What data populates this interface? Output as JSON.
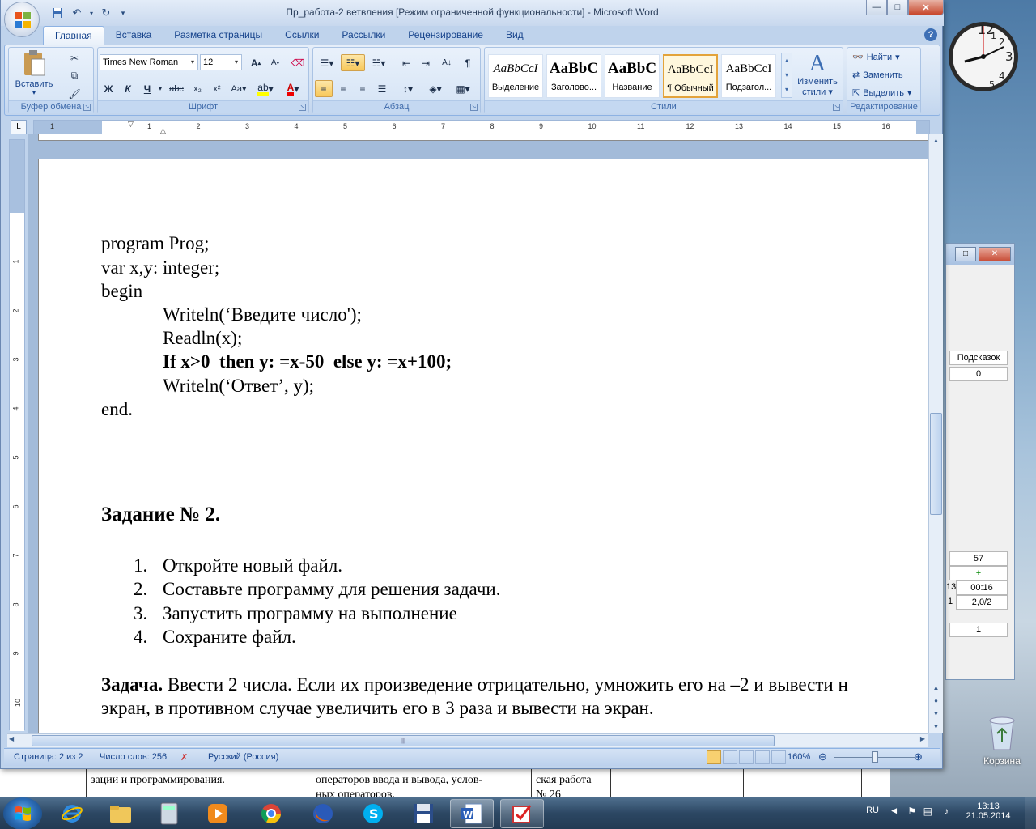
{
  "window": {
    "title": "Пр_работа-2 ветвления [Режим ограниченной функциональности] - Microsoft Word"
  },
  "tabs": [
    "Главная",
    "Вставка",
    "Разметка страницы",
    "Ссылки",
    "Рассылки",
    "Рецензирование",
    "Вид"
  ],
  "active_tab": "Главная",
  "ribbon": {
    "clipboard": {
      "label": "Буфер обмена",
      "paste": "Вставить"
    },
    "font": {
      "label": "Шрифт",
      "name": "Times New Roman",
      "size": "12"
    },
    "paragraph": {
      "label": "Абзац"
    },
    "styles": {
      "label": "Стили",
      "change": "Изменить",
      "change2": "стили",
      "items": [
        {
          "sample": "AaBbCcI",
          "name": "Выделение"
        },
        {
          "sample": "AaBbC",
          "name": "Заголово..."
        },
        {
          "sample": "AaBbC",
          "name": "Название"
        },
        {
          "sample": "AaBbCcI",
          "name": "¶ Обычный"
        },
        {
          "sample": "AaBbCcI",
          "name": "Подзагол..."
        }
      ]
    },
    "editing": {
      "label": "Редактирование",
      "find": "Найти",
      "replace": "Заменить",
      "select": "Выделить"
    }
  },
  "ruler": {
    "h": [
      "1",
      "1",
      "2",
      "3",
      "4",
      "5",
      "6",
      "7",
      "8",
      "9",
      "10",
      "11",
      "12",
      "13",
      "14",
      "15",
      "16"
    ],
    "v": [
      "1",
      "2",
      "3",
      "4",
      "5",
      "6",
      "7",
      "8",
      "9",
      "10"
    ]
  },
  "document": {
    "code": [
      "program Prog;",
      "var x,y: integer;",
      "begin",
      "Writeln(‘Введите число');",
      "Readln(x);",
      "If x>0  then y: =x-50  else y: =x+100;",
      "Writeln(‘Ответ’, y);",
      "end."
    ],
    "heading": "Задание № 2.",
    "steps": [
      {
        "n": "1.",
        "text": "Откройте новый файл."
      },
      {
        "n": "2.",
        "text": "Составьте программу для решения задачи."
      },
      {
        "n": "3.",
        "text": "Запустить программу на выполнение"
      },
      {
        "n": "4.",
        "text": "Сохраните файл."
      }
    ],
    "task_label": "Задача.",
    "task_line1": " Ввести 2 числа. Если их произведение отрицательно, умножить его на –2 и вывести н",
    "task_line2": "экран, в противном случае увеличить его в 3 раза и вывести на экран."
  },
  "status": {
    "page": "Страница: 2 из 2",
    "words": "Число слов: 256",
    "lang": "Русский (Россия)",
    "zoom": "160%"
  },
  "background_doc": {
    "c1": "зации и программирования.",
    "c2a": "операторов ввода и вывода, услов-",
    "c2b": "ных операторов.",
    "c3a": "ская работа",
    "c3b": "№ 26"
  },
  "background_window": {
    "header": "Подсказок",
    "v1": "0",
    "v2": "57",
    "v3": "+",
    "v4": "13",
    "v5": "00:16",
    "v6": "1",
    "v7": "2,0/2",
    "v8": "1"
  },
  "desktop": {
    "recycle_bin": "Корзина"
  },
  "tray": {
    "lang": "RU",
    "time": "13:13",
    "date": "21.05.2014"
  }
}
